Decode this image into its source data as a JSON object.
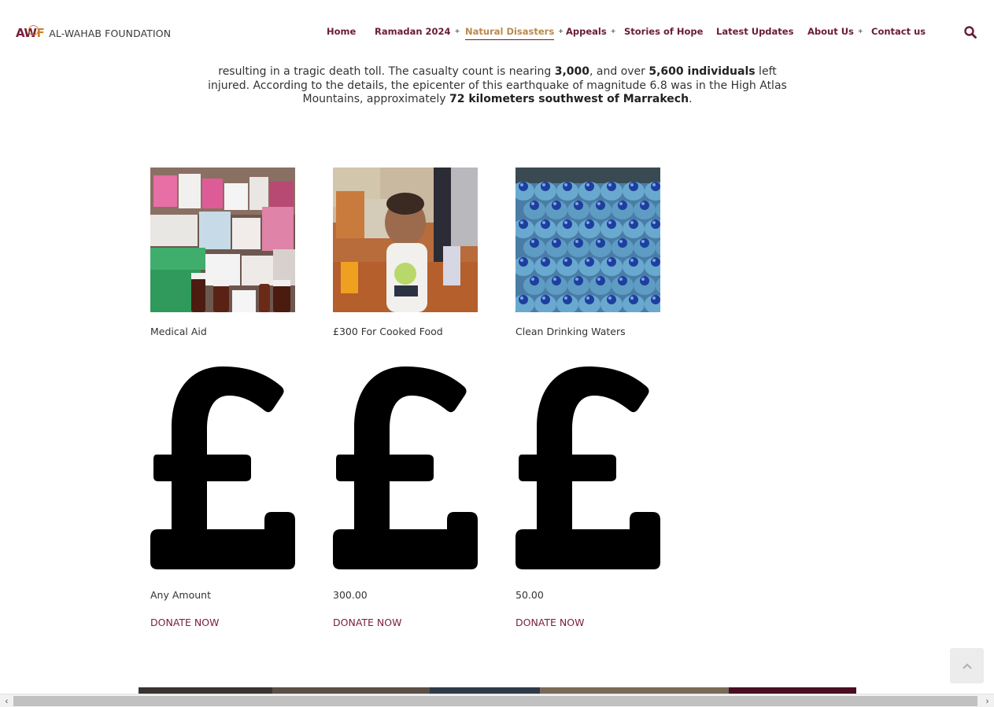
{
  "brand": {
    "logo_mark": "AW",
    "logo_mark_f": "F",
    "name": "AL-WAHAB FOUNDATION",
    "accent_color": "#7a1f3d",
    "gold_color": "#c9822c"
  },
  "nav": {
    "items": [
      {
        "label": "Home",
        "has_caret": false
      },
      {
        "label": "Ramadan 2024",
        "has_caret": true
      },
      {
        "label": "Natural Disasters",
        "has_caret": true,
        "active": true
      },
      {
        "label": "Appeals",
        "has_caret": true
      },
      {
        "label": "Stories of Hope",
        "has_caret": false
      },
      {
        "label": "Latest Updates",
        "has_caret": false
      },
      {
        "label": "About Us",
        "has_caret": true
      },
      {
        "label": "Contact us",
        "has_caret": false
      }
    ],
    "caret_glyph": "+",
    "search_icon": "search-icon"
  },
  "intro": {
    "p1": "resulting in a tragic death toll. The casualty count is nearing ",
    "b1": "3,000",
    "p2": ", and over ",
    "b2": "5,600 individuals",
    "p3": " left injured. According to the details, the epicenter of this earthquake of magnitude 6.8 was in the High Atlas Mountains, approximately ",
    "b3": "72 kilometers southwest of Marrakech",
    "p4": "."
  },
  "cards": [
    {
      "title": "Medical Aid",
      "image_icon": "medicine-photo",
      "currency_icon": "pound-icon",
      "amount": "Any Amount",
      "cta": "DONATE NOW"
    },
    {
      "title": "£300 For Cooked Food",
      "image_icon": "child-photo",
      "currency_icon": "pound-icon",
      "amount": "300.00",
      "cta": "DONATE NOW"
    },
    {
      "title": "Clean Drinking Waters",
      "image_icon": "water-bottles-photo",
      "currency_icon": "pound-icon",
      "amount": "50.00",
      "cta": "DONATE NOW"
    }
  ],
  "scroll": {
    "left_arrow": "‹",
    "right_arrow": "›",
    "to_top_icon": "chevron-up-icon"
  }
}
